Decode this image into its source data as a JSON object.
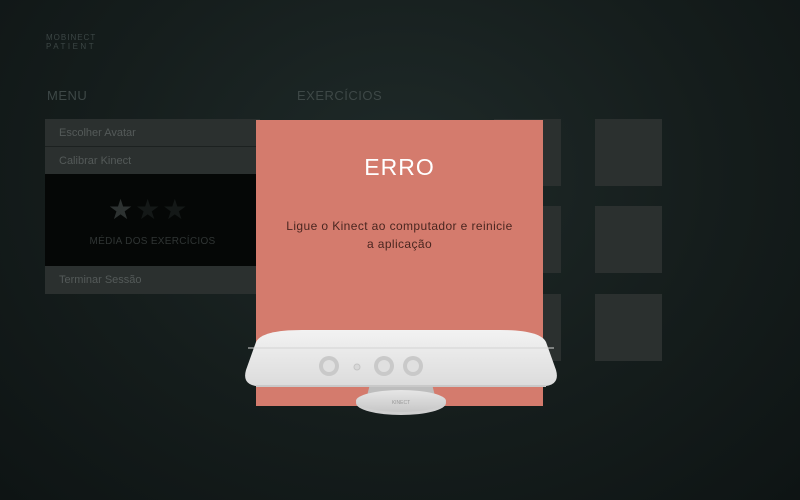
{
  "brand": {
    "line1": "MOBINECT",
    "line2": "PATIENT"
  },
  "menu": {
    "title": "MENU",
    "items": [
      {
        "label": "Escolher Avatar"
      },
      {
        "label": "Calibrar Kinect"
      },
      {
        "label": "Terminar Sessão"
      }
    ],
    "rating": {
      "label": "MÉDIA DOS EXERCÍCIOS",
      "stars_filled": 1,
      "stars_total": 3
    }
  },
  "exercises": {
    "title": "EXERCÍCIOS"
  },
  "dialog": {
    "title": "ERRO",
    "message": "Ligue o Kinect ao computador e reinicie a aplicação",
    "background_color": "#d47b6d"
  },
  "kinect": {
    "label": "KINECT"
  }
}
